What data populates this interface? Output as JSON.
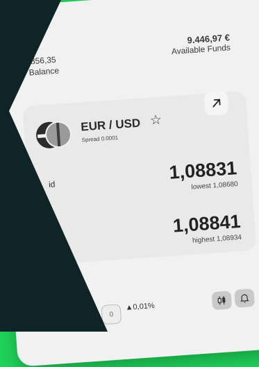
{
  "balance": {
    "amount": ".856,35",
    "label": "Balance"
  },
  "funds": {
    "amount": "9.446,97 €",
    "label": "Available Funds"
  },
  "instrument": {
    "pair": "EUR / USD",
    "spread": "Spread 0.0001"
  },
  "prices": {
    "bid_label": "id",
    "bid_value": "1,08831",
    "lowest": "lowest 1,08680",
    "ask_value": "1,08841",
    "highest": "highest 1,08934"
  },
  "footer": {
    "change": "▲0,01%",
    "partial_field": "0"
  },
  "icons": {
    "star": "star-icon",
    "expand": "arrow-up-right-icon",
    "candles": "candlestick-icon",
    "bell": "bell-icon"
  },
  "colors": {
    "background_green": "#1fd25a",
    "dark_overlay": "#0f2426",
    "card": "#f1f1f1"
  }
}
